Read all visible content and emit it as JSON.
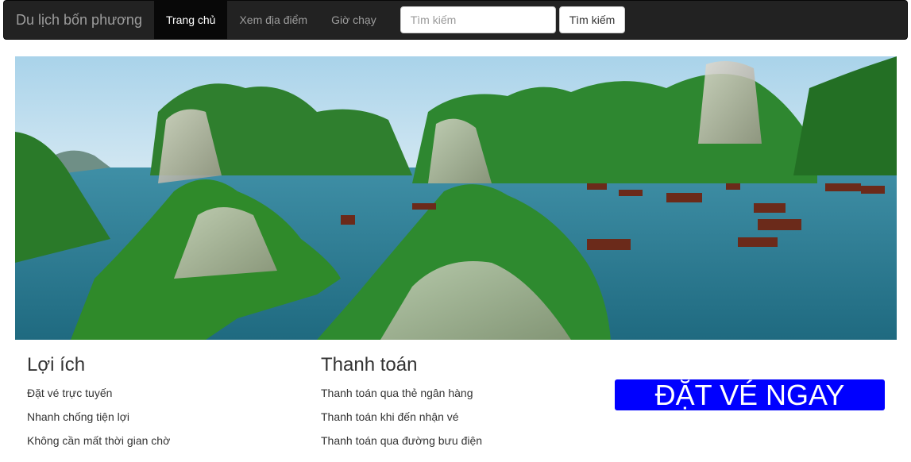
{
  "navbar": {
    "brand": "Du lịch bốn phương",
    "items": [
      {
        "label": "Trang chủ",
        "active": true
      },
      {
        "label": "Xem địa điểm",
        "active": false
      },
      {
        "label": "Giờ chạy",
        "active": false
      }
    ],
    "search": {
      "placeholder": "Tìm kiếm",
      "value": "",
      "button_label": "Tìm kiếm"
    }
  },
  "hero": {
    "image": "ha-long-bay-landscape",
    "colors": {
      "sky": "#b9dcef",
      "water": "#2f7f95",
      "foliage": "#2f8a2a",
      "rock": "#c9c3b8"
    }
  },
  "benefits": {
    "title": "Lợi ích",
    "items": [
      "Đặt vé trực tuyến",
      "Nhanh chống tiện lợi",
      "Không cần mất thời gian chờ"
    ]
  },
  "payment": {
    "title": "Thanh toán",
    "items": [
      "Thanh toán qua thẻ ngân hàng",
      "Thanh toán khi đến nhận vé",
      "Thanh toán qua đường bưu điện"
    ]
  },
  "cta": {
    "label": "ĐẶT VÉ NGAY",
    "color": "#0000ff"
  }
}
